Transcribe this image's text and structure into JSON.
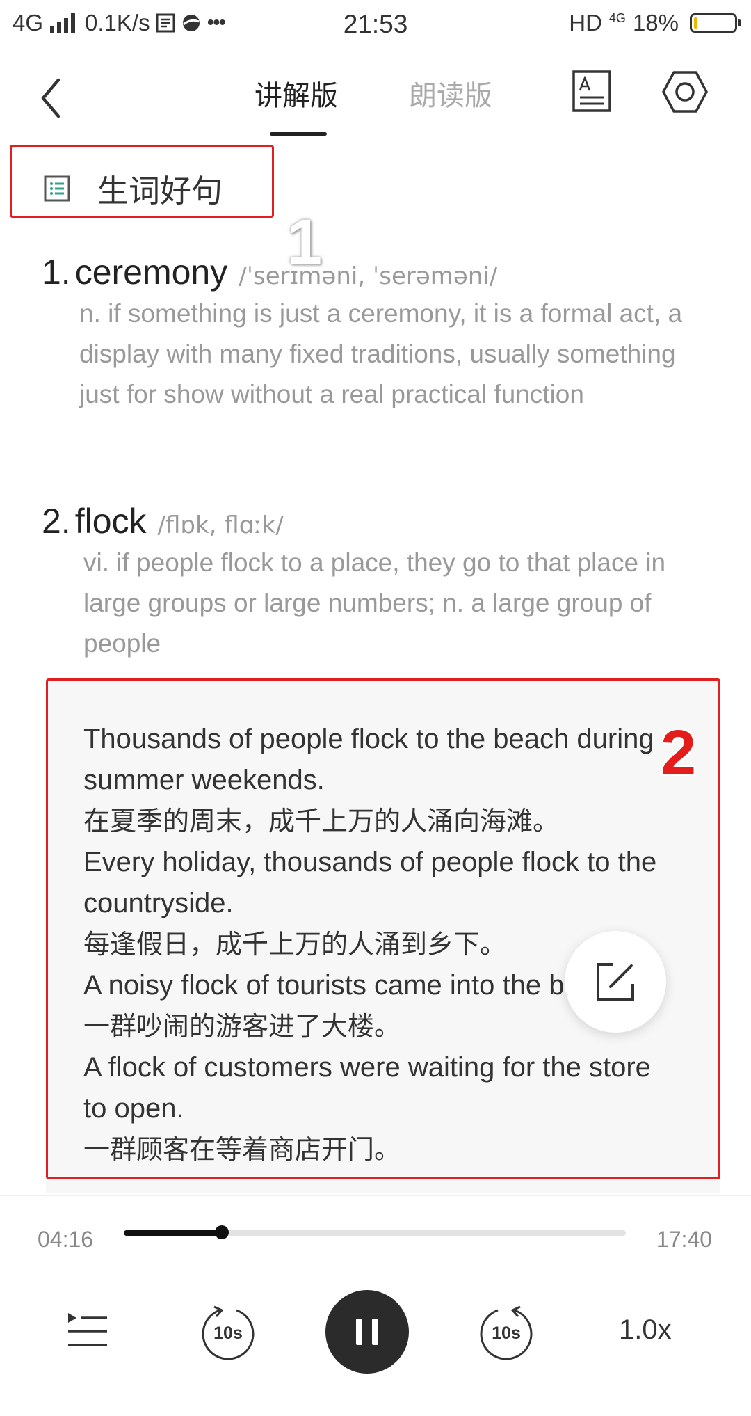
{
  "status_bar": {
    "network": "4G",
    "speed": "0.1K/s",
    "time": "21:53",
    "hd_label": "HD",
    "network_right": "4G",
    "battery": "18%",
    "battery_level": 0.18
  },
  "header": {
    "tab_explain": "讲解版",
    "tab_read": "朗读版"
  },
  "section": {
    "title": "生词好句"
  },
  "markers": {
    "one": "1",
    "two": "2"
  },
  "vocab": [
    {
      "number": "1.",
      "word": "ceremony",
      "ipa": "/ˈserɪməni, ˈserəməni/",
      "definition": "n. if something is just a ceremony, it is a formal act, a display with many fixed traditions, usually something just for show without a real practical function"
    },
    {
      "number": "2.",
      "word": "flock",
      "ipa": "/flɒk, flɑːk/",
      "definition": "vi. if people flock to a place, they go to that place in large groups or large numbers; n. a large group of people"
    }
  ],
  "examples": [
    {
      "en": "Thousands of people flock to the beach during summer weekends.",
      "zh": "在夏季的周末，成千上万的人涌向海滩。"
    },
    {
      "en": "Every holiday, thousands of people flock to the countryside.",
      "zh": "每逢假日，成千上万的人涌到乡下。"
    },
    {
      "en": "A noisy flock of tourists came into the building.",
      "zh": "一群吵闹的游客进了大楼。"
    },
    {
      "en": "A flock of customers were waiting for the store to open.",
      "zh": "一群顾客在等着商店开门。"
    }
  ],
  "player": {
    "current_time": "04:16",
    "total_time": "17:40",
    "progress": 0.195,
    "rewind_label": "10s",
    "forward_label": "10s",
    "speed": "1.0x"
  }
}
